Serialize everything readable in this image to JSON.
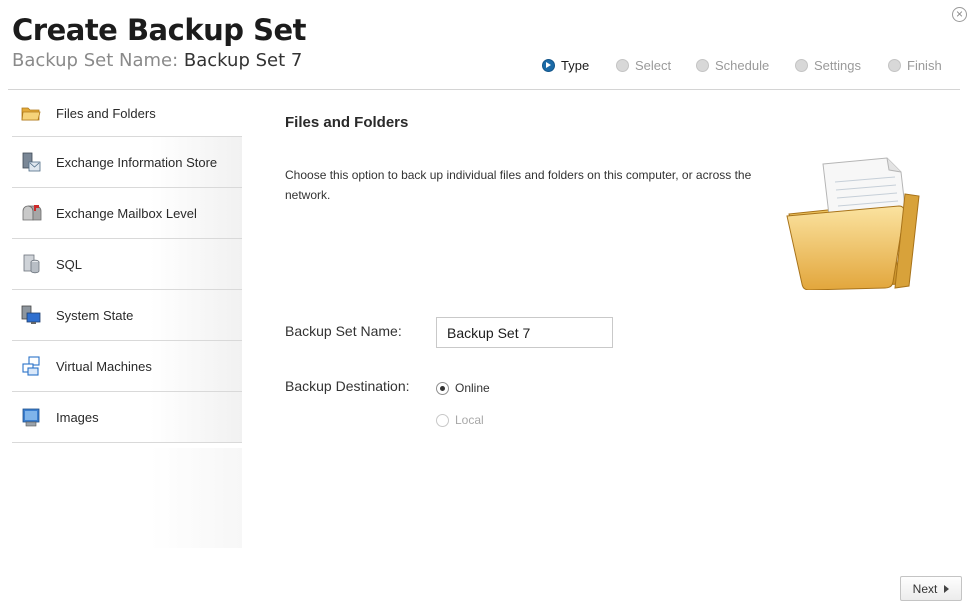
{
  "header": {
    "title": "Create Backup Set",
    "subtitle_label": "Backup Set Name:",
    "subtitle_value": "Backup Set 7"
  },
  "steps": [
    {
      "label": "Type",
      "active": true
    },
    {
      "label": "Select",
      "active": false
    },
    {
      "label": "Schedule",
      "active": false
    },
    {
      "label": "Settings",
      "active": false
    },
    {
      "label": "Finish",
      "active": false
    }
  ],
  "sidebar": {
    "items": [
      {
        "label": "Files and Folders",
        "icon": "folder-icon",
        "selected": true
      },
      {
        "label": "Exchange Information Store",
        "icon": "exchange-server-icon"
      },
      {
        "label": "Exchange Mailbox Level",
        "icon": "mailbox-icon"
      },
      {
        "label": "SQL",
        "icon": "database-icon"
      },
      {
        "label": "System State",
        "icon": "computer-icon"
      },
      {
        "label": "Virtual Machines",
        "icon": "virtual-machine-icon"
      },
      {
        "label": "Images",
        "icon": "disk-image-icon"
      }
    ]
  },
  "main": {
    "title": "Files and Folders",
    "description": "Choose this option to back up individual files and folders on this computer, or across the network.",
    "name_label": "Backup Set Name:",
    "name_value": "Backup Set 7",
    "destination_label": "Backup Destination:",
    "destination_options": [
      {
        "label": "Online",
        "selected": true,
        "enabled": true
      },
      {
        "label": "Local",
        "selected": false,
        "enabled": false
      }
    ]
  },
  "footer": {
    "next_label": "Next"
  },
  "colors": {
    "accent": "#1b6aa7",
    "folder": "#e9b94a"
  }
}
